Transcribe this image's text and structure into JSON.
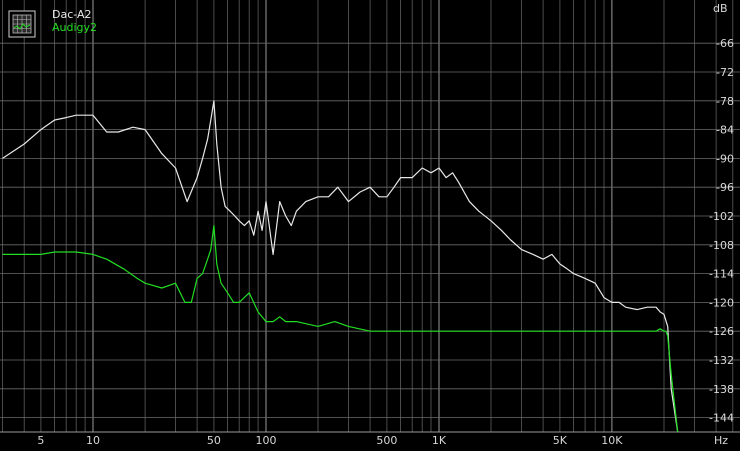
{
  "chart_data": {
    "type": "line",
    "x_scale": "log",
    "xlim": [
      2.9,
      55000
    ],
    "ylim": [
      -147,
      -57
    ],
    "y_unit": "dB",
    "x_unit": "Hz",
    "grid": true,
    "legend_position": "top-left",
    "x_tick_labels": [
      {
        "x": 5,
        "label": "5"
      },
      {
        "x": 10,
        "label": "10"
      },
      {
        "x": 50,
        "label": "50"
      },
      {
        "x": 100,
        "label": "100"
      },
      {
        "x": 500,
        "label": "500"
      },
      {
        "x": 1000,
        "label": "1K"
      },
      {
        "x": 5000,
        "label": "5K"
      },
      {
        "x": 10000,
        "label": "10K"
      }
    ],
    "y_tick_labels": [
      -66,
      -72,
      -78,
      -84,
      -90,
      -96,
      -102,
      -108,
      -114,
      -120,
      -126,
      -132,
      -138,
      -144
    ],
    "series": [
      {
        "name": "Dac-A2",
        "color": "#e8e8e8",
        "x": [
          3,
          4,
          5,
          6,
          7,
          8,
          9,
          10,
          12,
          14,
          17,
          20,
          25,
          30,
          35,
          40,
          43,
          46,
          48,
          50,
          52,
          55,
          58,
          62,
          66,
          70,
          75,
          80,
          85,
          90,
          95,
          100,
          110,
          120,
          130,
          140,
          150,
          170,
          200,
          230,
          260,
          300,
          350,
          400,
          450,
          500,
          550,
          600,
          700,
          800,
          900,
          1000,
          1100,
          1200,
          1300,
          1500,
          1700,
          2000,
          2300,
          2600,
          3000,
          3500,
          4000,
          4500,
          5000,
          5500,
          6000,
          7000,
          8000,
          9000,
          10000,
          11000,
          12000,
          14000,
          16000,
          18000,
          19000,
          20000,
          21000,
          22000,
          24000
        ],
        "y": [
          -90,
          -87,
          -84,
          -82,
          -81.5,
          -81,
          -81,
          -81,
          -84.5,
          -84.5,
          -83.5,
          -84,
          -89,
          -92,
          -99,
          -94,
          -90,
          -86,
          -82,
          -78,
          -87,
          -96,
          -100,
          -101,
          -102,
          -103,
          -104,
          -103,
          -106,
          -101,
          -105,
          -99,
          -110,
          -99,
          -102,
          -104,
          -101,
          -99,
          -98,
          -98,
          -96,
          -99,
          -97,
          -96,
          -98,
          -98,
          -96,
          -94,
          -94,
          -92,
          -93,
          -92,
          -94,
          -93,
          -95,
          -99,
          -101,
          -103,
          -105,
          -107,
          -109,
          -110,
          -111,
          -110,
          -112,
          -113,
          -114,
          -115,
          -116,
          -119,
          -120,
          -120,
          -121,
          -121.5,
          -121,
          -121,
          -122,
          -122.5,
          -125,
          -138,
          -147
        ]
      },
      {
        "name": "Audigy2",
        "color": "#22dd22",
        "x": [
          3,
          4,
          5,
          6,
          7,
          8,
          10,
          12,
          15,
          18,
          20,
          25,
          30,
          34,
          37,
          40,
          43,
          46,
          48,
          50,
          52,
          55,
          60,
          65,
          70,
          80,
          90,
          100,
          110,
          120,
          130,
          150,
          200,
          250,
          300,
          400,
          500,
          700,
          1000,
          1500,
          2000,
          3000,
          4000,
          5000,
          7000,
          10000,
          12000,
          14000,
          16000,
          18000,
          19000,
          20000,
          20500,
          21000,
          22000,
          24000
        ],
        "y": [
          -110,
          -110,
          -110,
          -109.5,
          -109.5,
          -109.5,
          -110,
          -111,
          -113,
          -115,
          -116,
          -117,
          -116,
          -120,
          -120,
          -115,
          -114,
          -111,
          -109,
          -104,
          -112,
          -116,
          -118,
          -120,
          -120,
          -118,
          -122,
          -124,
          -124,
          -123,
          -124,
          -124,
          -125,
          -124,
          -125,
          -126,
          -126,
          -126,
          -126,
          -126,
          -126,
          -126,
          -126,
          -126,
          -126,
          -126,
          -126,
          -126,
          -126,
          -126,
          -125.5,
          -126,
          -126,
          -127,
          -135,
          -147
        ]
      }
    ]
  }
}
